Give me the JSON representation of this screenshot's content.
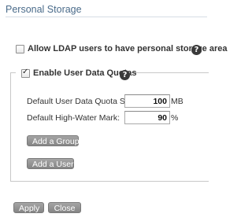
{
  "page": {
    "title": "Personal Storage"
  },
  "ldap": {
    "label": "Allow LDAP users to have personal storage area",
    "checked": false,
    "help_glyph": "?"
  },
  "quotas": {
    "label": "Enable User Data Quotas",
    "checked": true,
    "help_glyph": "?",
    "quota_size_label": "Default User Data Quota Size:",
    "quota_size_value": "100",
    "quota_size_unit": "MB",
    "high_water_label": "Default High-Water Mark:",
    "high_water_value": "90",
    "high_water_unit": "%",
    "add_group_label": "Add a Group",
    "add_user_label": "Add a User"
  },
  "footer": {
    "apply_label": "Apply",
    "close_label": "Close"
  }
}
